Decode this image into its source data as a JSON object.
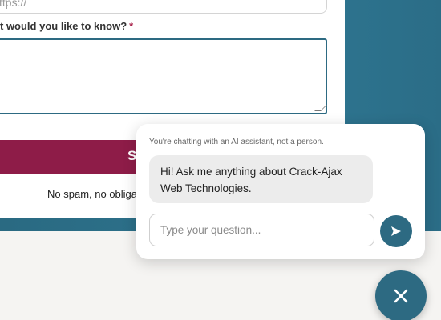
{
  "form": {
    "url_placeholder": "ttps://",
    "question_label": "t would you like to know?",
    "required_marker": "*",
    "submit_label": "S",
    "no_spam_text": "No spam, no obliga"
  },
  "chat": {
    "notice": "You're chatting with an AI assistant, not a person.",
    "greeting": "Hi! Ask me anything about Crack-Ajax Web Technologies.",
    "input_placeholder": "Type your question...",
    "send_icon": "send-arrow-icon",
    "close_icon": "close-icon"
  },
  "colors": {
    "teal": "#2d6a82",
    "burgundy": "#8e1c48",
    "required": "#a8204a"
  }
}
